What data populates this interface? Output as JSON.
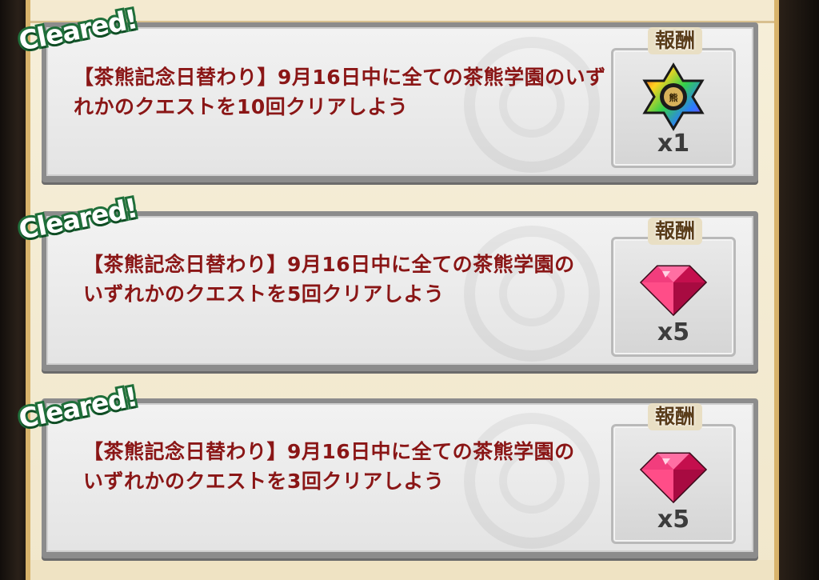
{
  "quests": [
    {
      "badge": "Cleared!",
      "text": "【茶熊記念日替わり】9月16日中に全ての茶熊学園のいずれかのクエストを10回クリアしよう",
      "reward_label": "報酬",
      "reward_icon": "rainbow-star-medal-icon",
      "reward_qty": "x1"
    },
    {
      "badge": "Cleared!",
      "text": "【茶熊記念日替わり】9月16日中に全ての茶熊学園のいずれかのクエストを5回クリアしよう",
      "reward_label": "報酬",
      "reward_icon": "pink-gem-icon",
      "reward_qty": "x5"
    },
    {
      "badge": "Cleared!",
      "text": "【茶熊記念日替わり】9月16日中に全ての茶熊学園のいずれかのクエストを3回クリアしよう",
      "reward_label": "報酬",
      "reward_icon": "pink-gem-icon",
      "reward_qty": "x5"
    }
  ],
  "colors": {
    "quest_text": "#8a1616",
    "badge_outline": "#1f6f3a",
    "gem": "#e01a5c"
  }
}
